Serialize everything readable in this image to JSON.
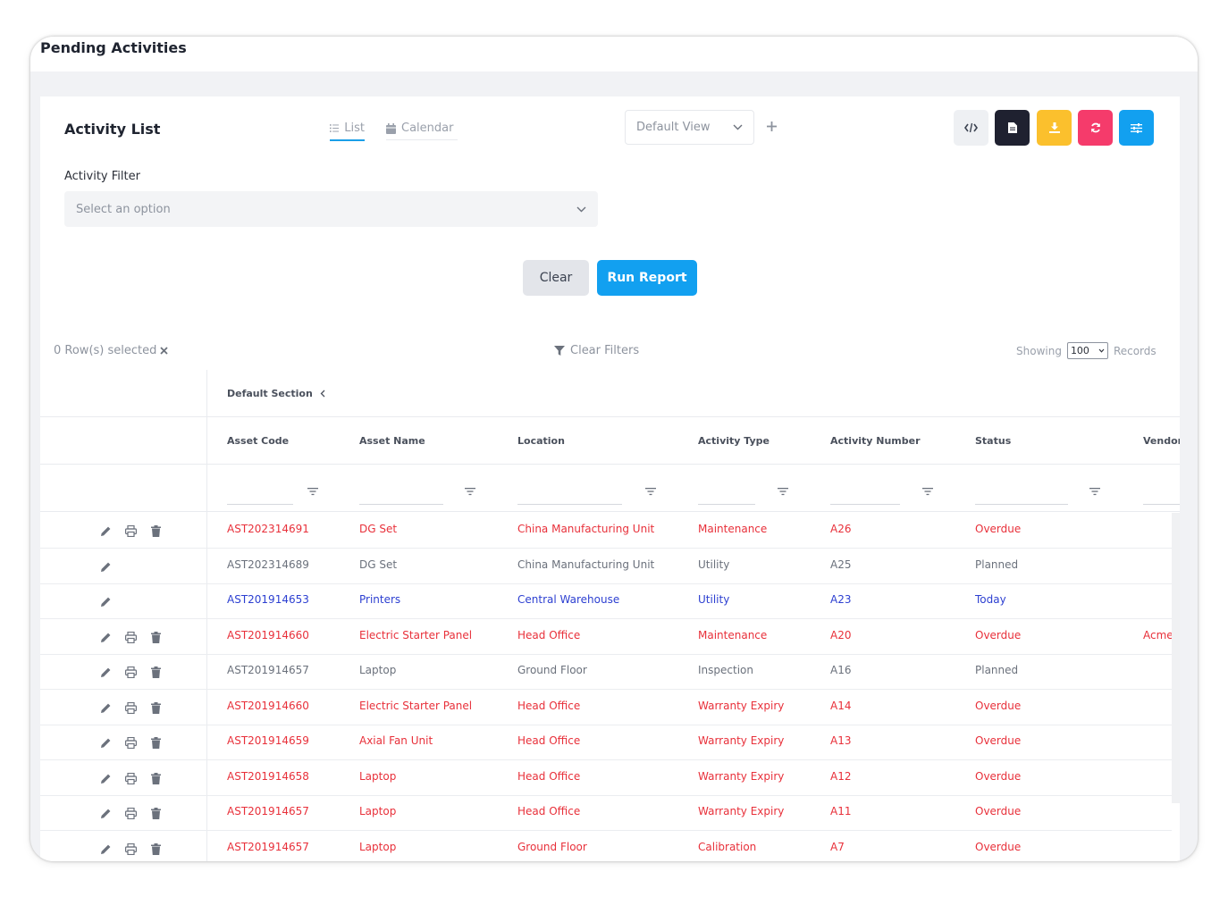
{
  "page": {
    "title": "Pending Activities"
  },
  "card": {
    "title": "Activity List",
    "tabs": [
      {
        "label": "List"
      },
      {
        "label": "Calendar"
      }
    ],
    "view_select": "Default View",
    "filter_label": "Activity Filter",
    "filter_placeholder": "Select an option",
    "clear_label": "Clear",
    "run_label": "Run Report",
    "toolbar_colors": {
      "code": "#eef0f3",
      "doc": "#1f2130",
      "download": "#fbc02d",
      "refresh": "#f53b6b",
      "settings": "#12a0f0"
    }
  },
  "table_controls": {
    "rows_selected": "0 Row(s) selected",
    "clear_filters": "Clear Filters",
    "showing_label": "Showing",
    "page_size": "100",
    "records_label": "Records"
  },
  "table": {
    "section": "Default Section",
    "columns": [
      "Asset Code",
      "Asset Name",
      "Location",
      "Activity Type",
      "Activity Number",
      "Status",
      "Vendor I"
    ],
    "rows": [
      {
        "status_color": "red",
        "icons": [
          "edit",
          "print",
          "delete"
        ],
        "asset_code": "AST202314691",
        "asset_name": "DG Set",
        "location": "China Manufacturing Unit",
        "activity_type": "Maintenance",
        "activity_number": "A26",
        "status": "Overdue",
        "vendor": ""
      },
      {
        "status_color": "gray",
        "icons": [
          "edit"
        ],
        "asset_code": "AST202314689",
        "asset_name": "DG Set",
        "location": "China Manufacturing Unit",
        "activity_type": "Utility",
        "activity_number": "A25",
        "status": "Planned",
        "vendor": ""
      },
      {
        "status_color": "blue",
        "icons": [
          "edit"
        ],
        "asset_code": "AST201914653",
        "asset_name": "Printers",
        "location": "Central Warehouse",
        "activity_type": "Utility",
        "activity_number": "A23",
        "status": "Today",
        "vendor": ""
      },
      {
        "status_color": "red",
        "icons": [
          "edit",
          "print",
          "delete"
        ],
        "asset_code": "AST201914660",
        "asset_name": "Electric Starter Panel",
        "location": "Head Office",
        "activity_type": "Maintenance",
        "activity_number": "A20",
        "status": "Overdue",
        "vendor": "Acme"
      },
      {
        "status_color": "gray",
        "icons": [
          "edit",
          "print",
          "delete"
        ],
        "asset_code": "AST201914657",
        "asset_name": "Laptop",
        "location": "Ground Floor",
        "activity_type": "Inspection",
        "activity_number": "A16",
        "status": "Planned",
        "vendor": ""
      },
      {
        "status_color": "red",
        "icons": [
          "edit",
          "print",
          "delete"
        ],
        "asset_code": "AST201914660",
        "asset_name": "Electric Starter Panel",
        "location": "Head Office",
        "activity_type": "Warranty Expiry",
        "activity_number": "A14",
        "status": "Overdue",
        "vendor": ""
      },
      {
        "status_color": "red",
        "icons": [
          "edit",
          "print",
          "delete"
        ],
        "asset_code": "AST201914659",
        "asset_name": "Axial Fan Unit",
        "location": "Head Office",
        "activity_type": "Warranty Expiry",
        "activity_number": "A13",
        "status": "Overdue",
        "vendor": ""
      },
      {
        "status_color": "red",
        "icons": [
          "edit",
          "print",
          "delete"
        ],
        "asset_code": "AST201914658",
        "asset_name": "Laptop",
        "location": "Head Office",
        "activity_type": "Warranty Expiry",
        "activity_number": "A12",
        "status": "Overdue",
        "vendor": ""
      },
      {
        "status_color": "red",
        "icons": [
          "edit",
          "print",
          "delete"
        ],
        "asset_code": "AST201914657",
        "asset_name": "Laptop",
        "location": "Head Office",
        "activity_type": "Warranty Expiry",
        "activity_number": "A11",
        "status": "Overdue",
        "vendor": ""
      },
      {
        "status_color": "red",
        "icons": [
          "edit",
          "print",
          "delete"
        ],
        "asset_code": "AST201914657",
        "asset_name": "Laptop",
        "location": "Ground Floor",
        "activity_type": "Calibration",
        "activity_number": "A7",
        "status": "Overdue",
        "vendor": ""
      }
    ]
  }
}
